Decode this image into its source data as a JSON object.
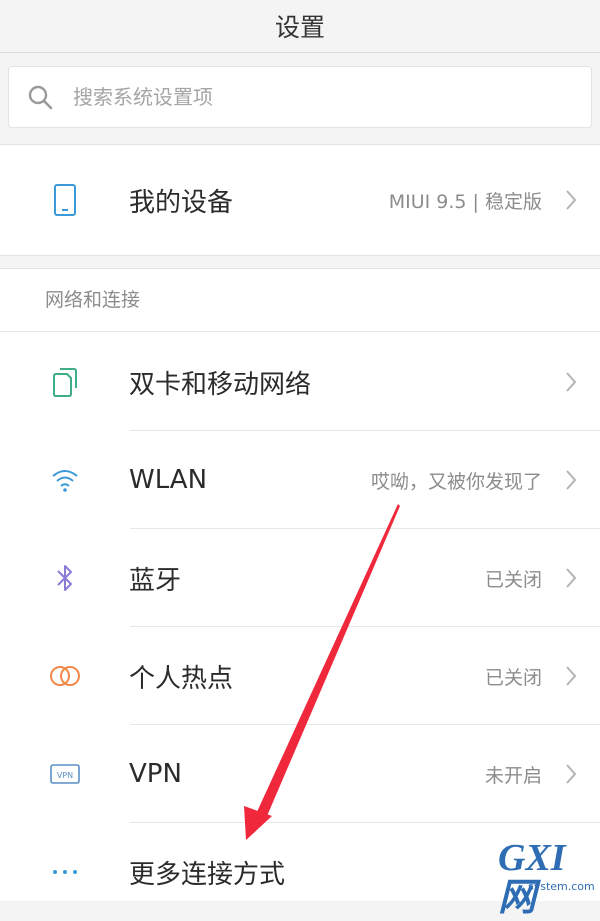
{
  "header": {
    "title": "设置"
  },
  "search": {
    "placeholder": "搜索系统设置项"
  },
  "device": {
    "label": "我的设备",
    "value": "MIUI 9.5 | 稳定版",
    "icon": "phone-icon"
  },
  "network": {
    "section_title": "网络和连接",
    "items": [
      {
        "label": "双卡和移动网络",
        "value": "",
        "icon": "sim-cards-icon"
      },
      {
        "label": "WLAN",
        "value": "哎呦，又被你发现了",
        "icon": "wifi-icon"
      },
      {
        "label": "蓝牙",
        "value": "已关闭",
        "icon": "bluetooth-icon"
      },
      {
        "label": "个人热点",
        "value": "已关闭",
        "icon": "hotspot-icon"
      },
      {
        "label": "VPN",
        "value": "未开启",
        "icon": "vpn-icon"
      },
      {
        "label": "更多连接方式",
        "value": "",
        "icon": "more-dots-icon"
      }
    ]
  },
  "annotation": {
    "color": "#f0283c"
  },
  "watermark": {
    "mark": "GXI网",
    "site": "system.com"
  },
  "colors": {
    "device_icon": "#3a9ad9",
    "sim_icon": "#3fae84",
    "wifi_icon": "#3a9ad9",
    "bluetooth_icon": "#8b7bd6",
    "hotspot_icon": "#f08a4b",
    "vpn_icon": "#5a8fc7",
    "more_icon": "#3a9ad9"
  }
}
